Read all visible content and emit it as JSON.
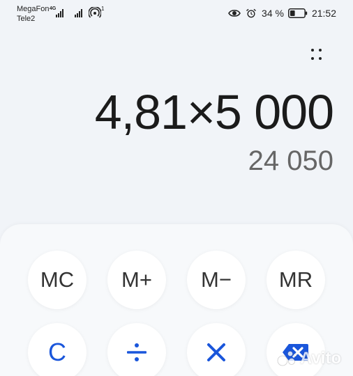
{
  "status_bar": {
    "carrier_1": "MegaFon",
    "carrier_2": "Tele2",
    "network_type": "4G",
    "hotspot_count": "1",
    "battery_percent": "34 %",
    "battery_level": 0.34,
    "time": "21:52",
    "icons": [
      "signal-icon",
      "signal-icon",
      "hotspot-icon",
      "eye-icon",
      "alarm-icon",
      "battery-icon"
    ]
  },
  "display": {
    "expression": "4,81×5 000",
    "result": "24 050",
    "menu_icon": "dots-grid-icon"
  },
  "keypad": {
    "row1": {
      "mc": "MC",
      "m_plus": "M+",
      "m_minus": "M−",
      "mr": "MR"
    },
    "row2": {
      "clear": "C",
      "divide": "÷",
      "multiply": "×",
      "backspace_icon": "backspace-icon"
    },
    "accent_color": "#1a56db"
  },
  "watermark": {
    "text": "Avito"
  }
}
